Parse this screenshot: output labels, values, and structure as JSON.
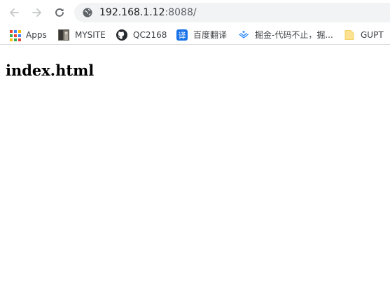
{
  "browser": {
    "url_host": "192.168.1.12",
    "url_rest": ":8088/"
  },
  "bookmarks": [
    {
      "label": "Apps",
      "icon": "apps-grid-icon"
    },
    {
      "label": "MYSITE",
      "icon": "site-favicon-icon"
    },
    {
      "label": "QC2168",
      "icon": "github-icon"
    },
    {
      "label": "百度翻译",
      "icon": "baidu-translate-icon"
    },
    {
      "label": "掘金-代码不止，掘...",
      "icon": "juejin-icon"
    },
    {
      "label": "GUPT",
      "icon": "folder-icon"
    }
  ],
  "page": {
    "heading": "index.html"
  },
  "colors": {
    "toolbar_icon": "#5f6368",
    "omnibox_bg": "#f1f3f4",
    "translate_blue": "#1a73e8",
    "juejin_blue": "#1e80ff",
    "folder_yellow": "#fde293"
  }
}
